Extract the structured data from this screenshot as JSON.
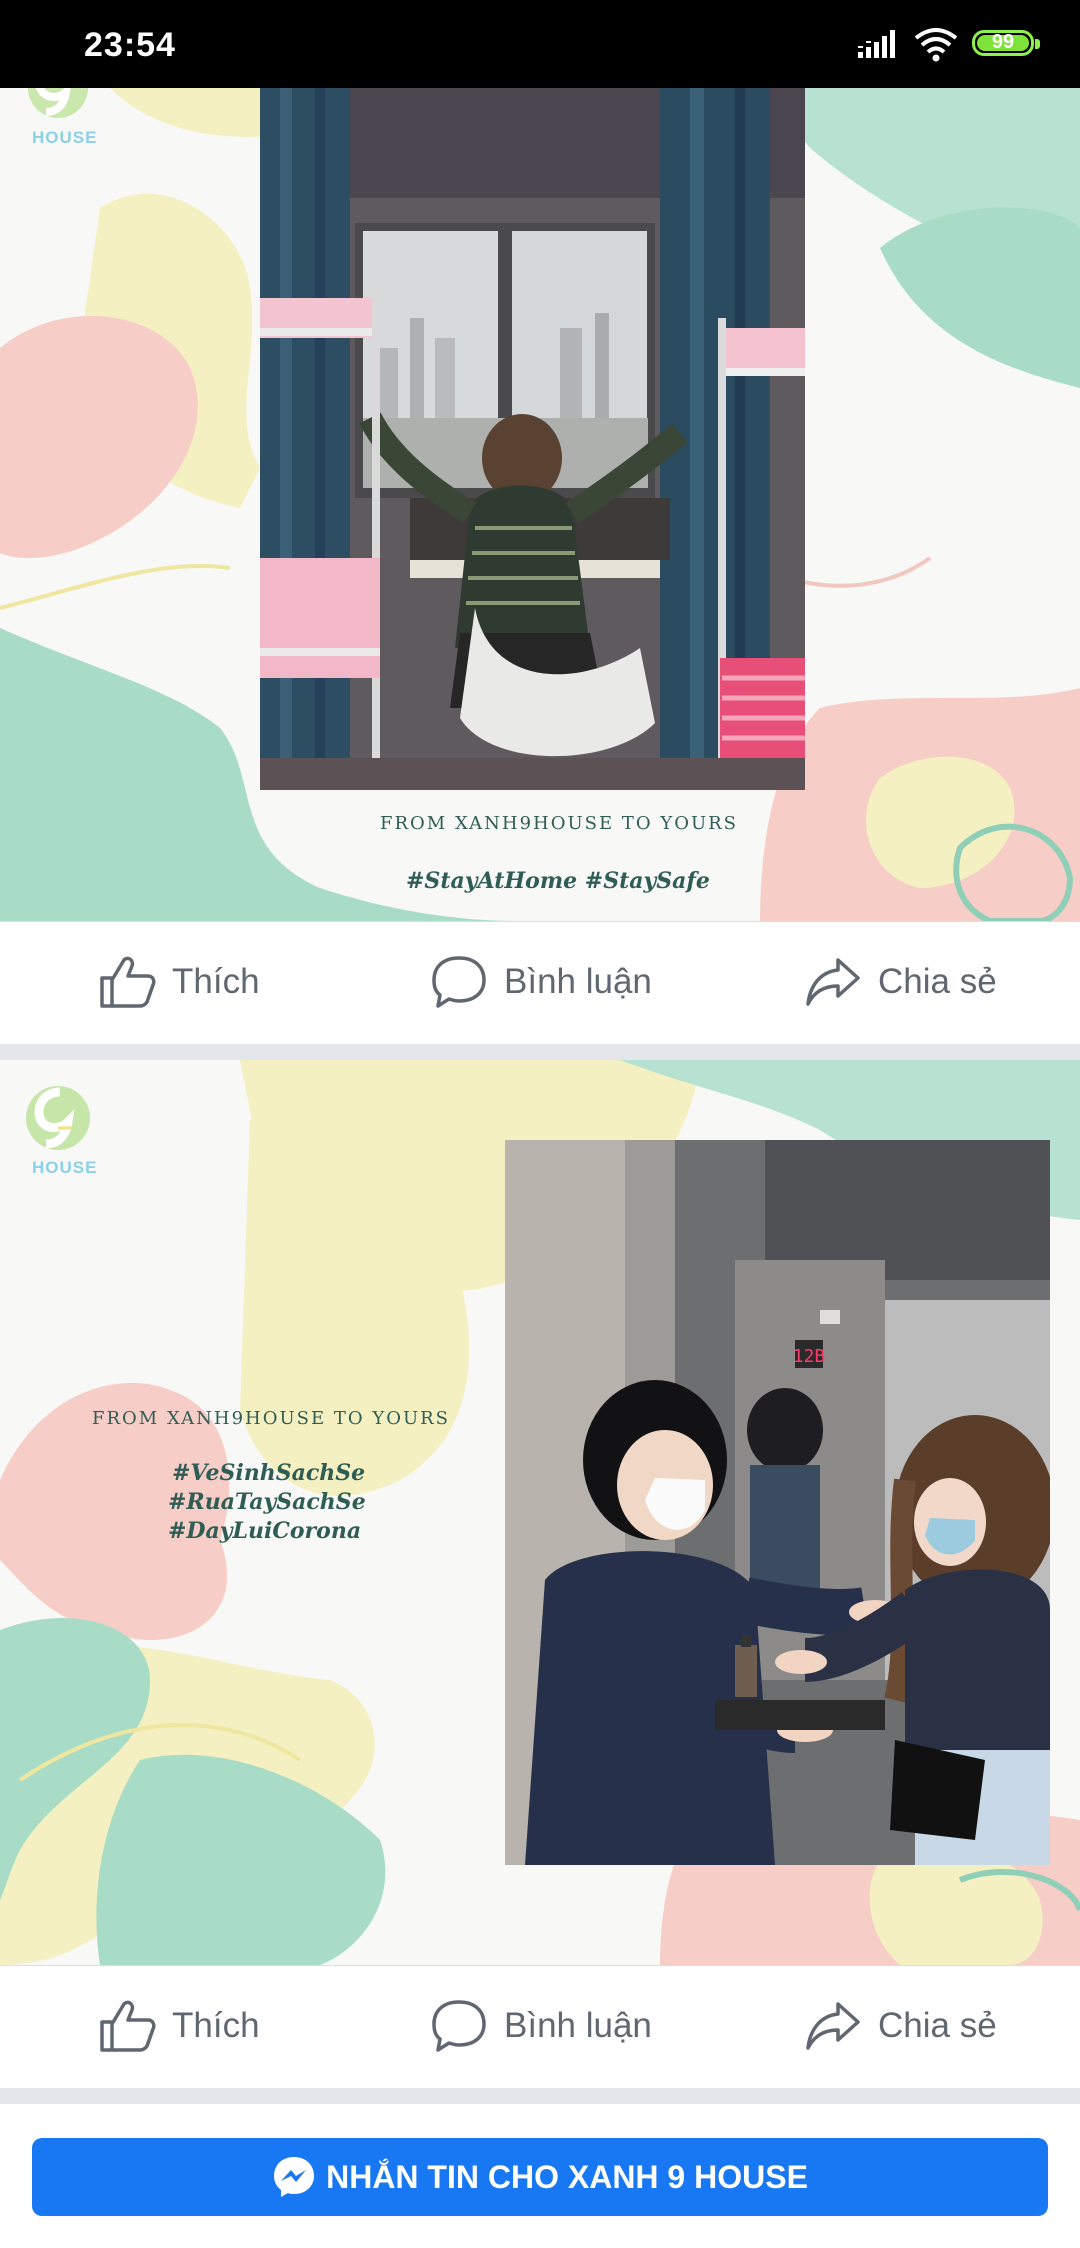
{
  "status_bar": {
    "time": "23:54",
    "battery_level": "99",
    "icons": [
      "signal-icon",
      "wifi-icon",
      "battery-icon"
    ]
  },
  "posts": [
    {
      "logo_text": "HOUSE",
      "caption_line": "FROM XANH9HOUSE TO YOURS",
      "hashtags": "#StayAtHome #StaySafe",
      "actions": {
        "like": "Thích",
        "comment": "Bình luận",
        "share": "Chia sẻ"
      }
    },
    {
      "logo_text": "HOUSE",
      "caption_line": "FROM XANH9HOUSE TO YOURS",
      "hashtag_1": "#VeSinhSachSe",
      "hashtag_2": "#RuaTaySachSe",
      "hashtag_3": "#DayLuiCorona",
      "elevator_floor": "12B",
      "actions": {
        "like": "Thích",
        "comment": "Bình luận",
        "share": "Chia sẻ"
      }
    }
  ],
  "messenger_button": {
    "label": "NHẮN TIN CHO XANH 9 HOUSE"
  },
  "colors": {
    "accent": "#1877f2",
    "mint": "#a9dcc7",
    "pink": "#f7c9c4",
    "yellow": "#f3efbd",
    "action_text": "#606770"
  }
}
